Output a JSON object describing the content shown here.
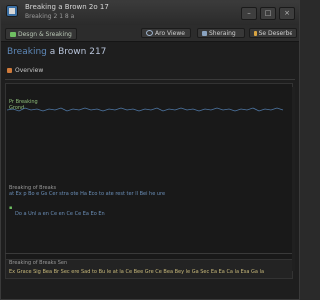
{
  "window": {
    "title": "Breaking a Brown 2o 17",
    "subtitle": "Breaking 2 1 8 a"
  },
  "toolbar": {
    "breadcrumb": "Desgn & Sreaking",
    "view_label": "Aro Viewe",
    "share_label": "Sheraing",
    "download_label": "Se Deserbed Hitaries"
  },
  "page": {
    "title_lead": "Breaking",
    "title_rest": "a Brown 217",
    "overview_tab": "Overview"
  },
  "panel": {
    "label_top": "Pr Breaking",
    "label_top2": "Grond",
    "log_label": "Breaking of Breaks",
    "log_line1": "at Ex p Bo e Gs Cer stra ote Ha Eco to ate rest ter ll Bei he ure",
    "log_line2": "Do a Unl a en Ce en Ce Ce Ea Eo En",
    "bottom_label": "Breaking of Breaks Sen",
    "bottom_status": "Ex Grace Sig Bea Br Sec ere Sad to Bu le at la Ce Bee Gre Ce Bea Bey le Ga Sec Ea Ea Ca la Esa Ga la"
  },
  "colors": {
    "accent": "#5d87b6",
    "green": "#6fbf62",
    "gold": "#c8b97a",
    "background": "#1e1e1e"
  },
  "icons": {
    "app": "app-icon",
    "breadcrumb": "folder-icon",
    "view": "eye-icon",
    "share": "share-icon",
    "download": "download-icon",
    "overview": "overview-icon"
  }
}
